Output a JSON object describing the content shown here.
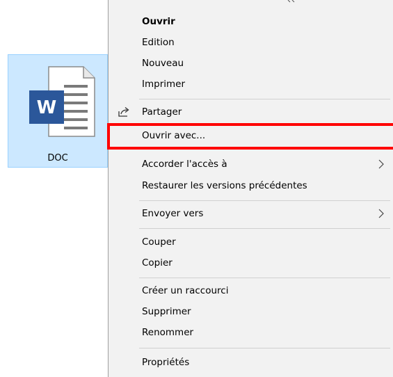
{
  "file": {
    "name": "DOC",
    "icon": "word-document-icon",
    "icon_letter": "W"
  },
  "context_menu": {
    "items": [
      {
        "label": "Ouvrir",
        "bold": true
      },
      {
        "label": "Edition"
      },
      {
        "label": "Nouveau"
      },
      {
        "label": "Imprimer"
      },
      {
        "label": "Partager",
        "icon": "share-icon"
      },
      {
        "label": "Ouvrir avec...",
        "highlighted": true
      },
      {
        "label": "Accorder l'accès à",
        "submenu": true
      },
      {
        "label": "Restaurer les versions précédentes"
      },
      {
        "label": "Envoyer vers",
        "submenu": true
      },
      {
        "label": "Couper"
      },
      {
        "label": "Copier"
      },
      {
        "label": "Créer un raccourci"
      },
      {
        "label": "Supprimer"
      },
      {
        "label": "Renommer"
      },
      {
        "label": "Propriétés"
      }
    ]
  },
  "colors": {
    "selection_bg": "#cce8ff",
    "selection_border": "#99d1ff",
    "menu_bg": "#f2f2f2",
    "highlight": "#ff0000",
    "word_blue": "#2b579a"
  }
}
